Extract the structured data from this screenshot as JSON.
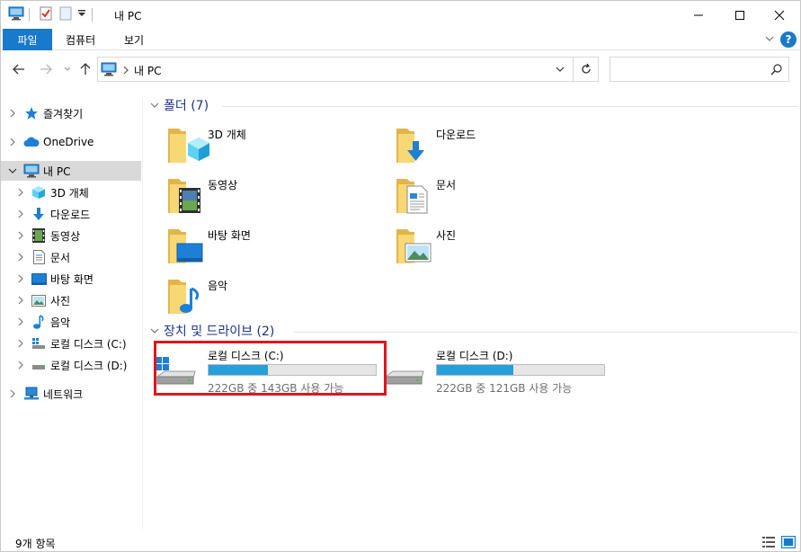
{
  "window": {
    "title": "내 PC",
    "controls": [
      "minimize-icon",
      "maximize-icon",
      "close-icon"
    ]
  },
  "ribbon": {
    "tabs": [
      {
        "label": "파일",
        "active": true
      },
      {
        "label": "컴퓨터"
      },
      {
        "label": "보기"
      }
    ],
    "help_label": "?"
  },
  "address_bar": {
    "path": [
      "내 PC"
    ]
  },
  "sidebar": {
    "items": [
      {
        "label": "즐겨찾기",
        "icon": "star-icon",
        "level": 0
      },
      {
        "label": "OneDrive",
        "icon": "cloud-icon",
        "level": 0
      },
      {
        "label": "내 PC",
        "icon": "computer-icon",
        "level": 0,
        "expanded": true,
        "selected": true
      },
      {
        "label": "3D 개체",
        "icon": "cube-icon",
        "level": 1
      },
      {
        "label": "다운로드",
        "icon": "download-icon",
        "level": 1
      },
      {
        "label": "동영상",
        "icon": "video-icon",
        "level": 1
      },
      {
        "label": "문서",
        "icon": "document-icon",
        "level": 1
      },
      {
        "label": "바탕 화면",
        "icon": "desktop-icon",
        "level": 1
      },
      {
        "label": "사진",
        "icon": "picture-icon",
        "level": 1
      },
      {
        "label": "음악",
        "icon": "music-icon",
        "level": 1
      },
      {
        "label": "로컬 디스크 (C:)",
        "icon": "drive-c-icon",
        "level": 1
      },
      {
        "label": "로컬 디스크 (D:)",
        "icon": "drive-icon",
        "level": 1
      },
      {
        "label": "네트워크",
        "icon": "network-icon",
        "level": 0
      }
    ]
  },
  "content": {
    "folders_header": "폴더 (7)",
    "folders": [
      {
        "label": "3D 개체",
        "icon": "cube-folder-icon"
      },
      {
        "label": "다운로드",
        "icon": "download-folder-icon"
      },
      {
        "label": "동영상",
        "icon": "video-folder-icon"
      },
      {
        "label": "문서",
        "icon": "document-folder-icon"
      },
      {
        "label": "바탕 화면",
        "icon": "desktop-folder-icon"
      },
      {
        "label": "사진",
        "icon": "picture-folder-icon"
      },
      {
        "label": "음악",
        "icon": "music-folder-icon"
      }
    ],
    "drives_header": "장치 및 드라이브 (2)",
    "drives": [
      {
        "name": "로컬 디스크 (C:)",
        "free": "222GB 중 143GB 사용 가능",
        "used_fraction": 0.356,
        "highlighted": true
      },
      {
        "name": "로컬 디스크 (D:)",
        "free": "222GB 중 121GB 사용 가능",
        "used_fraction": 0.455
      }
    ]
  },
  "status": {
    "item_count": "9개 항목"
  },
  "colors": {
    "accent": "#1979ca",
    "drive_bar": "#26a0da",
    "group_header": "#1e3287",
    "highlight": "#e0141e",
    "folder_yellow": "#f8d775"
  }
}
